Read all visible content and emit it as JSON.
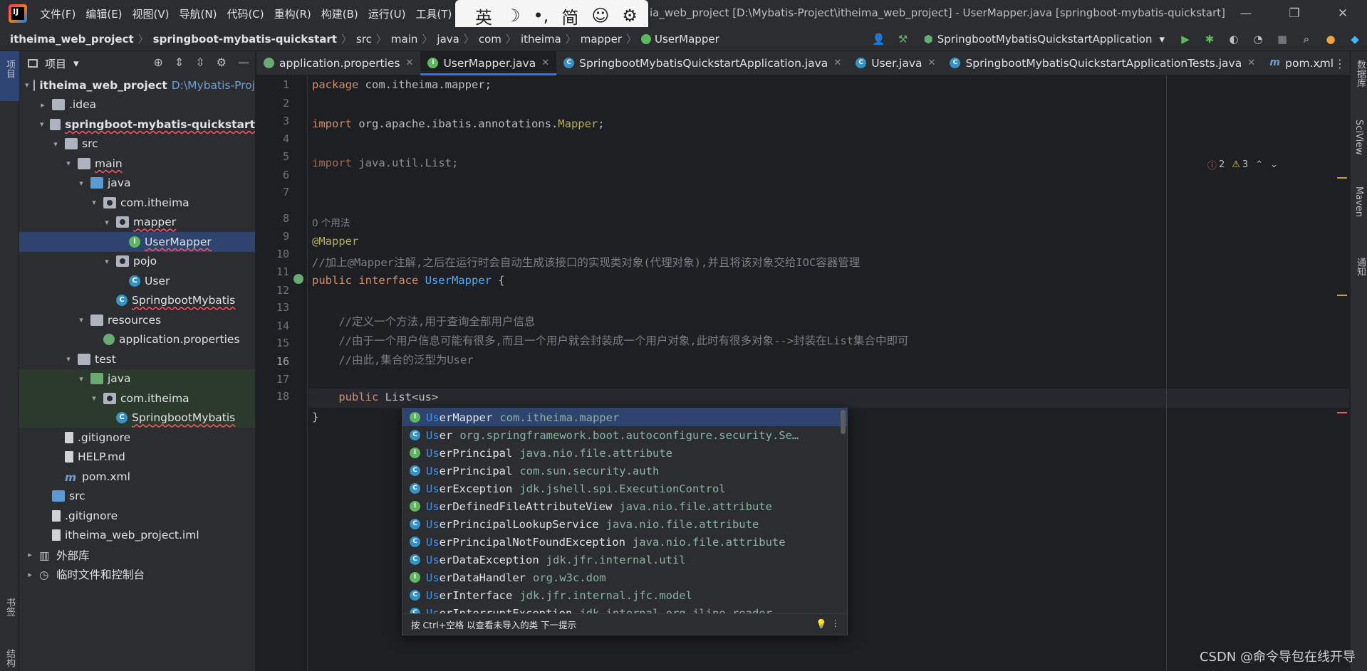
{
  "titlebar": {
    "logo_text": "IJ",
    "menus": [
      "文件(F)",
      "编辑(E)",
      "视图(V)",
      "导航(N)",
      "代码(C)",
      "重构(R)",
      "构建(B)",
      "运行(U)",
      "工具(T)"
    ],
    "window_title": "ia_web_project [D:\\Mybatis-Project\\itheima_web_project] - UserMapper.java [springboot-mybatis-quickstart]",
    "ime": [
      "英",
      "☽",
      "•,",
      "简",
      "☺",
      "⚙"
    ],
    "controls": [
      "—",
      "❐",
      "✕"
    ]
  },
  "breadcrumb": [
    "itheima_web_project",
    "springboot-mybatis-quickstart",
    "src",
    "main",
    "java",
    "com",
    "itheima",
    "mapper",
    "UserMapper"
  ],
  "run": {
    "config": "SpringbootMybatisQuickstartApplication"
  },
  "leftstrip": {
    "top": "项目",
    "bookmarks": "书签",
    "structure": "结构"
  },
  "rightstrip": [
    "数据库",
    "SciView",
    "Maven",
    "通知"
  ],
  "project": {
    "title": "项目",
    "tree": [
      {
        "label": "itheima_web_project",
        "path": "D:\\Mybatis-Proj",
        "depth": 0,
        "arrow": "▾",
        "icon": "folder",
        "bold": true
      },
      {
        "label": ".idea",
        "depth": 1,
        "arrow": "▸",
        "icon": "folder"
      },
      {
        "label": "springboot-mybatis-quickstart",
        "depth": 1,
        "arrow": "▾",
        "icon": "folder",
        "bold": true
      },
      {
        "label": "src",
        "depth": 2,
        "arrow": "▾",
        "icon": "folder"
      },
      {
        "label": "main",
        "depth": 3,
        "arrow": "▾",
        "icon": "folder"
      },
      {
        "label": "java",
        "depth": 4,
        "arrow": "▾",
        "icon": "folder-blue"
      },
      {
        "label": "com.itheima",
        "depth": 5,
        "arrow": "▾",
        "icon": "folder-pkg"
      },
      {
        "label": "mapper",
        "depth": 6,
        "arrow": "▾",
        "icon": "folder-pkg"
      },
      {
        "label": "UserMapper",
        "depth": 7,
        "arrow": "",
        "icon": "interface",
        "selected": true
      },
      {
        "label": "pojo",
        "depth": 6,
        "arrow": "▾",
        "icon": "folder-pkg"
      },
      {
        "label": "User",
        "depth": 7,
        "arrow": "",
        "icon": "class"
      },
      {
        "label": "SpringbootMybatis",
        "depth": 6,
        "arrow": "",
        "icon": "class"
      },
      {
        "label": "resources",
        "depth": 4,
        "arrow": "▾",
        "icon": "folder"
      },
      {
        "label": "application.properties",
        "depth": 5,
        "arrow": "",
        "icon": "class-green"
      },
      {
        "label": "test",
        "depth": 3,
        "arrow": "▾",
        "icon": "folder"
      },
      {
        "label": "java",
        "depth": 4,
        "arrow": "▾",
        "icon": "folder-green",
        "test": true
      },
      {
        "label": "com.itheima",
        "depth": 5,
        "arrow": "▾",
        "icon": "folder-pkg",
        "test": true
      },
      {
        "label": "SpringbootMybatis",
        "depth": 6,
        "arrow": "",
        "icon": "class",
        "test": true
      },
      {
        "label": ".gitignore",
        "depth": 2,
        "arrow": "",
        "icon": "file"
      },
      {
        "label": "HELP.md",
        "depth": 2,
        "arrow": "",
        "icon": "file"
      },
      {
        "label": "pom.xml",
        "depth": 2,
        "arrow": "",
        "icon": "maven"
      },
      {
        "label": "src",
        "depth": 1,
        "arrow": "",
        "icon": "folder-blue"
      },
      {
        "label": ".gitignore",
        "depth": 1,
        "arrow": "",
        "icon": "file"
      },
      {
        "label": "itheima_web_project.iml",
        "depth": 1,
        "arrow": "",
        "icon": "file"
      },
      {
        "label": "外部库",
        "depth": 0,
        "arrow": "▸",
        "icon": "lib"
      },
      {
        "label": "临时文件和控制台",
        "depth": 0,
        "arrow": "▸",
        "icon": "scratch"
      }
    ]
  },
  "tabs": [
    {
      "label": "application.properties",
      "icon": "green"
    },
    {
      "label": "UserMapper.java",
      "icon": "interface",
      "active": true
    },
    {
      "label": "SpringbootMybatisQuickstartApplication.java",
      "icon": "class"
    },
    {
      "label": "User.java",
      "icon": "class"
    },
    {
      "label": "SpringbootMybatisQuickstartApplicationTests.java",
      "icon": "class"
    },
    {
      "label": "pom.xml",
      "icon": "maven"
    }
  ],
  "inspections": {
    "errors": "2",
    "warnings": "3"
  },
  "editor": {
    "line_numbers": [
      "1",
      "2",
      "3",
      "4",
      "5",
      "6",
      "7",
      "8",
      "9",
      "10",
      "11",
      "12",
      "13",
      "14",
      "15",
      "16",
      "17",
      "18"
    ],
    "usage_hint": "0 个用法",
    "current_line": "16",
    "lines": {
      "l1_kw": "package",
      "l1_rest": " com.itheima.mapper;",
      "l3_kw": "import",
      "l3_rest": " org.apache.ibatis.annotations.",
      "l3_ann": "Mapper",
      "l3_end": ";",
      "l5_kw": "import",
      "l5_rest": " java.util.List;",
      "l8": "@Mapper",
      "l9": "//加上@Mapper注解,之后在运行时会自动生成该接口的实现类对象(代理对象),并且将该对象交给IOC容器管理",
      "l10_kw": "public interface",
      "l10_name": " UserMapper",
      "l10_rest": " {",
      "l12": "    //定义一个方法,用于查询全部用户信息",
      "l13": "    //由于一个用户信息可能有很多,而且一个用户就会封装成一个用户对象,此时有很多对象-->封装在List集合中即可",
      "l14": "    //由此,集合的泛型为User",
      "l16_kw": "    public",
      "l16_rest": " List<us>",
      "l17": "}"
    }
  },
  "completion": {
    "items": [
      {
        "match": "Us",
        "rest": "erMapper",
        "pkg": "com.itheima.mapper",
        "icon": "i"
      },
      {
        "match": "Us",
        "rest": "er",
        "pkg": "org.springframework.boot.autoconfigure.security.Se…",
        "icon": "c"
      },
      {
        "match": "Us",
        "rest": "erPrincipal",
        "pkg": "java.nio.file.attribute",
        "icon": "i"
      },
      {
        "match": "Us",
        "rest": "erPrincipal",
        "pkg": "com.sun.security.auth",
        "icon": "c"
      },
      {
        "match": "Us",
        "rest": "erException",
        "pkg": "jdk.jshell.spi.ExecutionControl",
        "icon": "c"
      },
      {
        "match": "Us",
        "rest": "erDefinedFileAttributeView",
        "pkg": "java.nio.file.attribute",
        "icon": "i"
      },
      {
        "match": "Us",
        "rest": "erPrincipalLookupService",
        "pkg": "java.nio.file.attribute",
        "icon": "c"
      },
      {
        "match": "Us",
        "rest": "erPrincipalNotFoundException",
        "pkg": "java.nio.file.attribute",
        "icon": "c"
      },
      {
        "match": "Us",
        "rest": "erDataException",
        "pkg": "jdk.jfr.internal.util",
        "icon": "c"
      },
      {
        "match": "Us",
        "rest": "erDataHandler",
        "pkg": "org.w3c.dom",
        "icon": "i"
      },
      {
        "match": "Us",
        "rest": "erInterface",
        "pkg": "jdk.jfr.internal.jfc.model",
        "icon": "c"
      },
      {
        "match": "Us",
        "rest": "erInterruptException",
        "pkg": "jdk.internal.org.jline.reader",
        "icon": "c"
      }
    ],
    "footer": "按 Ctrl+空格 以查看未导入的类  下一提示"
  },
  "watermark": "CSDN @命令导包在线开导"
}
